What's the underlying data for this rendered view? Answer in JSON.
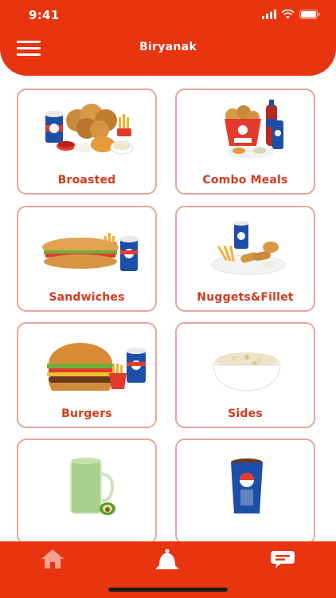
{
  "status": {
    "time": "9:41"
  },
  "header": {
    "title": "Biryanak"
  },
  "categories": [
    {
      "label": "Broasted"
    },
    {
      "label": "Combo Meals"
    },
    {
      "label": "Sandwiches"
    },
    {
      "label": "Nuggets&Fillet"
    },
    {
      "label": "Burgers"
    },
    {
      "label": "Sides"
    },
    {
      "label": ""
    },
    {
      "label": ""
    }
  ],
  "bottom_nav": [
    {
      "icon": "home-icon"
    },
    {
      "icon": "bell-icon"
    },
    {
      "icon": "chat-icon"
    }
  ],
  "colors": {
    "primary": "#E8340F",
    "card_border": "#E8A49A",
    "label": "#D6391B"
  }
}
